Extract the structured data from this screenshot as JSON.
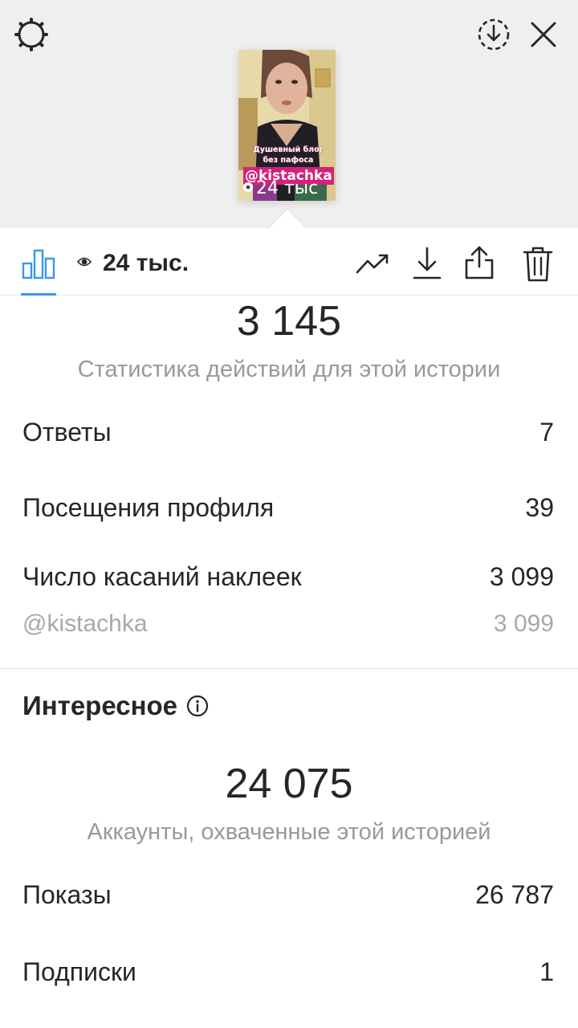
{
  "header": {
    "story_thumbnail": {
      "caption": "Душевный блог без пафоса",
      "handle": "@kistachka",
      "views": "24 тыс"
    }
  },
  "toolbar": {
    "views_count": "24 тыс."
  },
  "actions": {
    "total": "3 145",
    "label": "Статистика действий для этой истории",
    "rows": [
      {
        "label": "Ответы",
        "value": "7"
      },
      {
        "label": "Посещения профиля",
        "value": "39"
      },
      {
        "label": "Число касаний наклеек",
        "value": "3 099"
      },
      {
        "label": "@kistachka",
        "value": "3 099"
      }
    ]
  },
  "discovery": {
    "title": "Интересное",
    "total": "24 075",
    "label": "Аккаунты, охваченные этой историей",
    "rows": [
      {
        "label": "Показы",
        "value": "26 787"
      },
      {
        "label": "Подписки",
        "value": "1"
      }
    ]
  },
  "colors": {
    "accent": "#3897f0",
    "muted_text": "#999999",
    "sticker_pink": "#d6207a"
  }
}
